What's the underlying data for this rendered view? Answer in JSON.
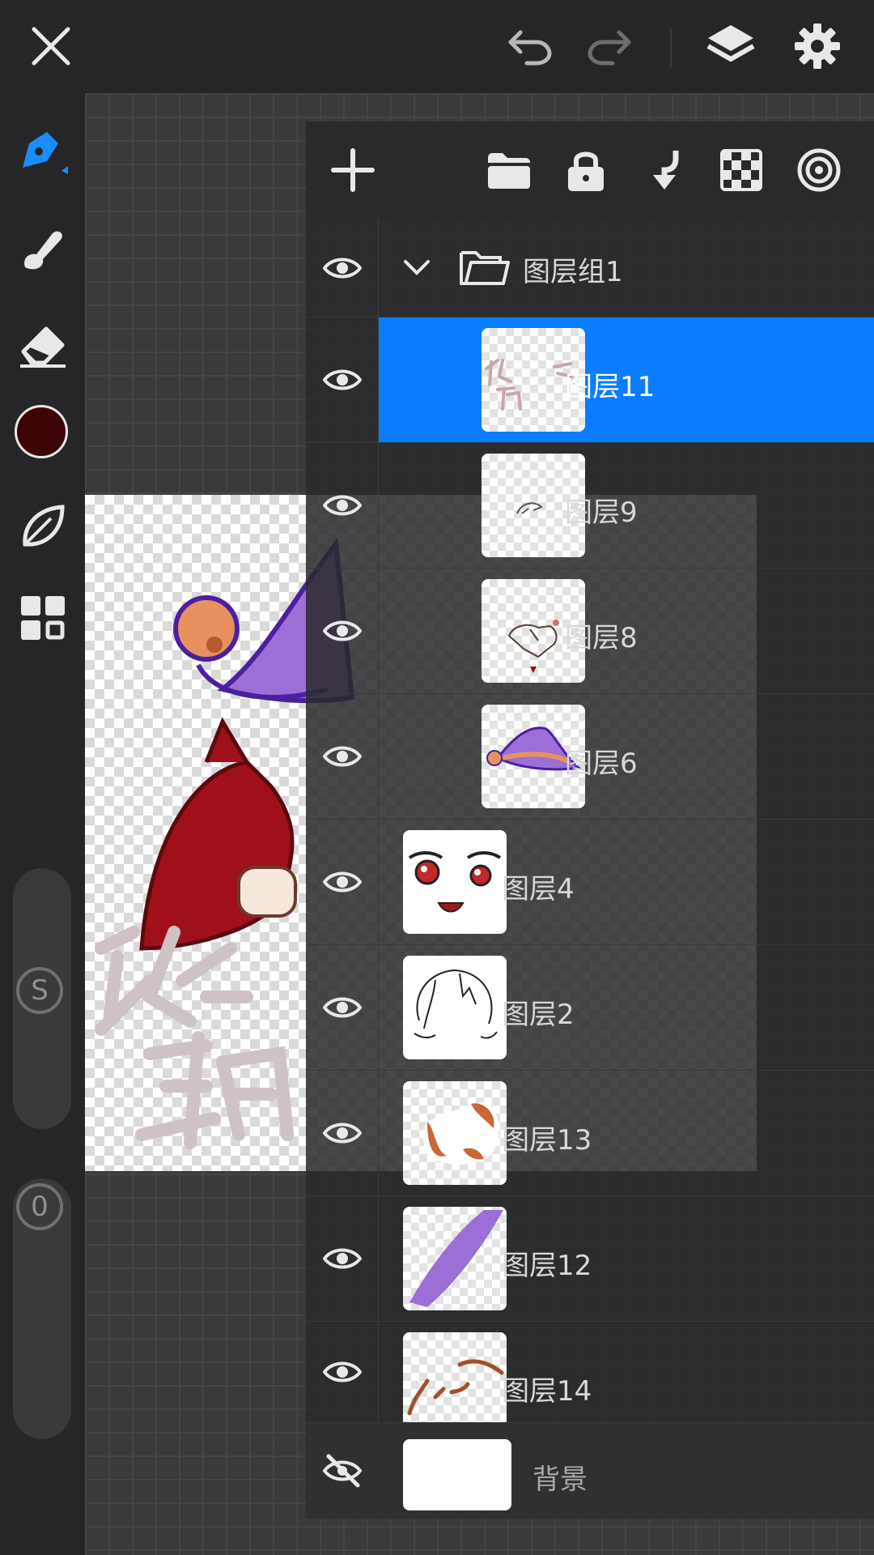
{
  "colors": {
    "accent": "#0a7cff",
    "current_brush_color": "#3d0408",
    "icon": "#e8e8e8",
    "icon_disabled": "#6e6e70"
  },
  "topbar": {
    "close_icon": "close-icon",
    "undo_icon": "undo-icon",
    "redo_icon": "redo-icon",
    "layers_icon": "layers-icon",
    "settings_icon": "gear-icon"
  },
  "sidebar": {
    "tools": [
      "pen-icon",
      "smudge-icon",
      "eraser-icon",
      "color-swatch",
      "leaf-brush-icon",
      "gallery-icon"
    ],
    "size_slider_label": "S",
    "opacity_slider_label": "0"
  },
  "layers_panel": {
    "toolbar": [
      "add-layer-icon",
      "folder-icon",
      "lock-icon",
      "merge-down-icon",
      "transparency-icon",
      "blend-target-icon"
    ],
    "group": {
      "name": "图层组1",
      "expanded": true
    },
    "layers": [
      {
        "name": "图层11",
        "selected": true,
        "in_group": true
      },
      {
        "name": "图层9",
        "selected": false,
        "in_group": true
      },
      {
        "name": "图层8",
        "selected": false,
        "in_group": true
      },
      {
        "name": "图层6",
        "selected": false,
        "in_group": true
      },
      {
        "name": "图层4",
        "selected": false,
        "in_group": false
      },
      {
        "name": "图层2",
        "selected": false,
        "in_group": false
      },
      {
        "name": "图层13",
        "selected": false,
        "in_group": false
      },
      {
        "name": "图层12",
        "selected": false,
        "in_group": false
      },
      {
        "name": "图层14",
        "selected": false,
        "in_group": false
      }
    ],
    "background": {
      "name": "背景",
      "visible": false
    }
  }
}
